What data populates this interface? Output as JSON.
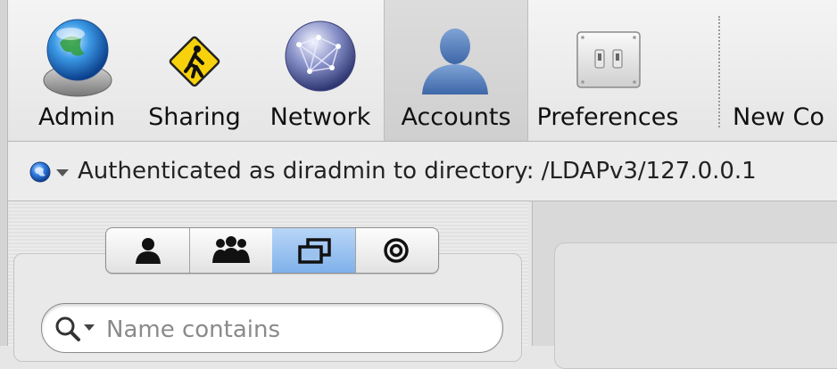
{
  "toolbar": {
    "items": [
      {
        "label": "Admin",
        "icon": "admin-globe-icon"
      },
      {
        "label": "Sharing",
        "icon": "sharing-sign-icon"
      },
      {
        "label": "Network",
        "icon": "network-globe-icon"
      },
      {
        "label": "Accounts",
        "icon": "accounts-person-icon",
        "selected": true
      },
      {
        "label": "Preferences",
        "icon": "preferences-switches-icon"
      },
      {
        "label": "New Co",
        "icon": "new-computer-icon"
      }
    ]
  },
  "status": {
    "text": "Authenticated as diradmin to directory: /LDAPv3/127.0.0.1",
    "icon": "globe-menu-icon"
  },
  "segments": {
    "items": [
      {
        "icon": "user-icon"
      },
      {
        "icon": "group-icon"
      },
      {
        "icon": "computer-lists-icon",
        "selected": true
      },
      {
        "icon": "target-icon"
      }
    ]
  },
  "search": {
    "placeholder": "Name contains",
    "icon": "search-icon"
  },
  "colors": {
    "accent": "#7fb1ea",
    "toolbar_bg": "#ececec"
  }
}
